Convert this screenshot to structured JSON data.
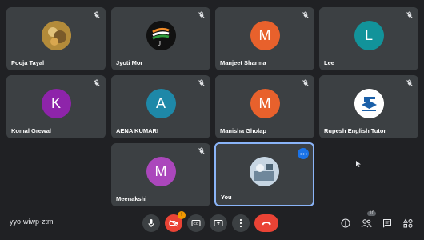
{
  "participants": [
    {
      "name": "Pooja Tayal",
      "avatar_type": "photo",
      "initial": "",
      "color": "#c9a24a"
    },
    {
      "name": "Jyoti Mor",
      "avatar_type": "photo",
      "initial": "",
      "color": "#111111"
    },
    {
      "name": "Manjeet Sharma",
      "avatar_type": "initial",
      "initial": "M",
      "color": "#e8612c"
    },
    {
      "name": "Lee",
      "avatar_type": "initial",
      "initial": "L",
      "color": "#12939a"
    },
    {
      "name": "Komal Grewal",
      "avatar_type": "initial",
      "initial": "K",
      "color": "#8e24aa"
    },
    {
      "name": "AENA KUMARI",
      "avatar_type": "initial",
      "initial": "A",
      "color": "#1e88a8"
    },
    {
      "name": "Manisha Gholap",
      "avatar_type": "initial",
      "initial": "M",
      "color": "#e8612c"
    },
    {
      "name": "Rupesh English Tutor",
      "avatar_type": "logo",
      "initial": "",
      "color": "#ffffff"
    },
    {
      "name": "Meenakshi",
      "avatar_type": "initial",
      "initial": "M",
      "color": "#ab47bc"
    },
    {
      "name": "You",
      "avatar_type": "photo",
      "initial": "",
      "color": "#9fb6cc"
    }
  ],
  "meeting": {
    "code": "yyo-wiwp-ztm"
  },
  "toolbar": {
    "camera_badge": "!",
    "participants_count": "10"
  },
  "colors": {
    "background": "#202124",
    "tile": "#3c4043",
    "hangup": "#ea4335",
    "self_border": "#8ab4f8"
  }
}
